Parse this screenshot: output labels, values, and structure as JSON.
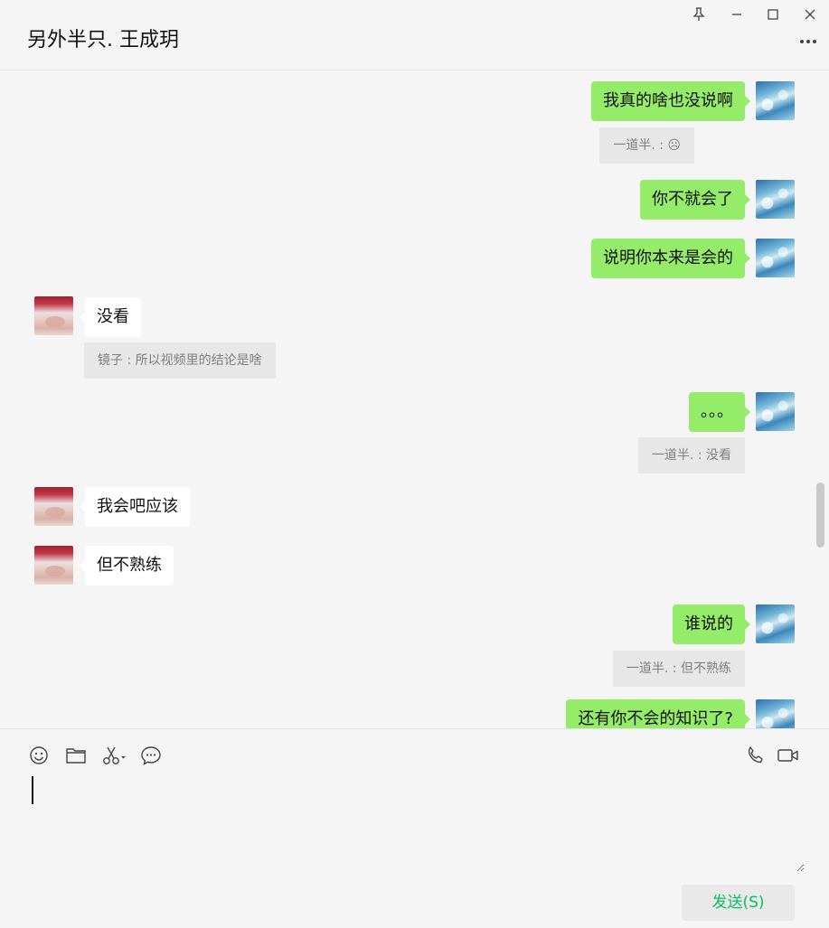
{
  "window": {
    "title": "另外半只. 王成玥",
    "controls": [
      "pin-icon",
      "minimize-icon",
      "maximize-icon",
      "close-icon"
    ],
    "more_icon": "more-dots-icon"
  },
  "messages": [
    {
      "from": "me",
      "text": "我真的啥也没说啊",
      "quote": "一道半. : ☹"
    },
    {
      "from": "me",
      "text": "你不就会了"
    },
    {
      "from": "me",
      "text": "说明你本来是会的"
    },
    {
      "from": "them",
      "text": "没看",
      "quote": "镜子 : 所以视频里的结论是啥"
    },
    {
      "from": "me",
      "text": "。。。",
      "quote": "一道半. : 没看"
    },
    {
      "from": "them",
      "text": "我会吧应该"
    },
    {
      "from": "them",
      "text": "但不熟练"
    },
    {
      "from": "me",
      "text": "谁说的",
      "quote": "一道半. : 但不熟练"
    },
    {
      "from": "me",
      "text": "还有你不会的知识了?"
    }
  ],
  "toolbar": {
    "left": [
      "emoji-icon",
      "folder-icon",
      "scissors-icon",
      "chat-history-icon"
    ],
    "right": [
      "voice-call-icon",
      "video-call-icon"
    ]
  },
  "composer": {
    "value": "",
    "send_label": "发送(S)"
  },
  "colors": {
    "me_bubble": "#95ec69",
    "them_bubble": "#ffffff",
    "background": "#f5f5f5",
    "send_text": "#07c160"
  }
}
